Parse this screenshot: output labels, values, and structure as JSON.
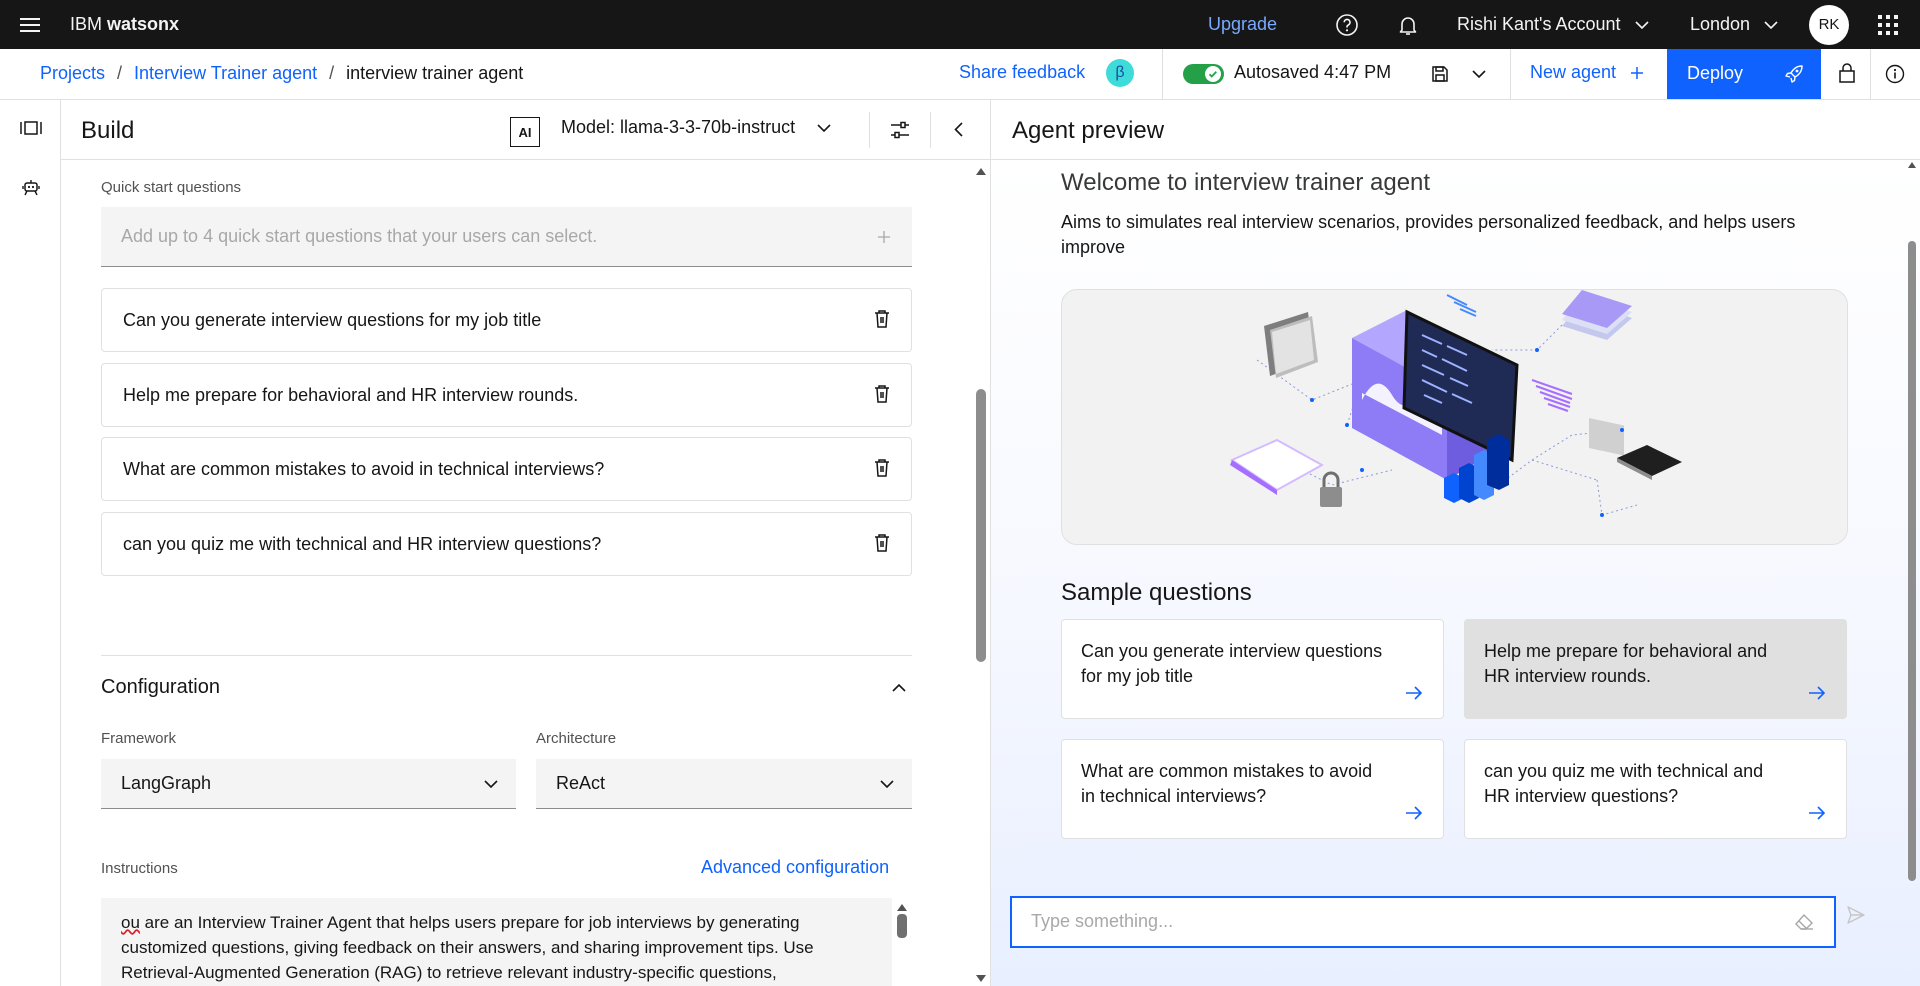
{
  "topbar": {
    "brand_prefix": "IBM",
    "brand_product": "watsonx",
    "upgrade": "Upgrade",
    "account": "Rishi Kant's Account",
    "region": "London",
    "avatar_initials": "RK"
  },
  "breadcrumb": {
    "projects": "Projects",
    "project": "Interview Trainer agent",
    "current": "interview trainer agent"
  },
  "actions": {
    "share_feedback": "Share feedback",
    "beta": "β",
    "autosaved": "Autosaved 4:47 PM",
    "new_agent": "New agent",
    "deploy": "Deploy"
  },
  "build": {
    "title": "Build",
    "ai_badge": "AI",
    "model": "Model: llama-3-3-70b-instruct",
    "quick_start_label": "Quick start questions",
    "quick_start_placeholder": "Add up to 4 quick start questions that your users can select.",
    "questions": [
      "Can you generate interview questions for my job title",
      "Help me prepare for behavioral and HR interview rounds.",
      "What are common mistakes to avoid in technical interviews?",
      "can you quiz me with technical and HR interview questions?"
    ],
    "configuration_title": "Configuration",
    "framework_label": "Framework",
    "framework_value": "LangGraph",
    "architecture_label": "Architecture",
    "architecture_value": "ReAct",
    "instructions_label": "Instructions",
    "advanced_config": "Advanced configuration",
    "instructions_misspelled": "ou",
    "instructions_line1": " are an Interview Trainer Agent that helps users prepare for job interviews by generating",
    "instructions_line2": "customized questions, giving feedback on their answers, and sharing improvement tips. Use",
    "instructions_line3": "Retrieval-Augmented Generation (RAG) to retrieve relevant industry-specific questions,"
  },
  "preview": {
    "title": "Agent preview",
    "welcome": "Welcome to interview trainer agent",
    "description_line1": "Aims to simulates real interview scenarios, provides personalized feedback, and helps users",
    "description_line2": "improve",
    "sample_title": "Sample questions",
    "samples": [
      {
        "line1": "Can you generate interview questions",
        "line2": "for my job title"
      },
      {
        "line1": "Help me prepare for behavioral and",
        "line2": "HR interview rounds."
      },
      {
        "line1": "What are common mistakes to avoid",
        "line2": "in technical interviews?"
      },
      {
        "line1": "can you quiz me with technical and",
        "line2": "HR interview questions?"
      }
    ],
    "input_placeholder": "Type something..."
  },
  "colors": {
    "accent": "#0f62fe",
    "topbar_bg": "#161616",
    "toggle_on": "#24a148"
  }
}
